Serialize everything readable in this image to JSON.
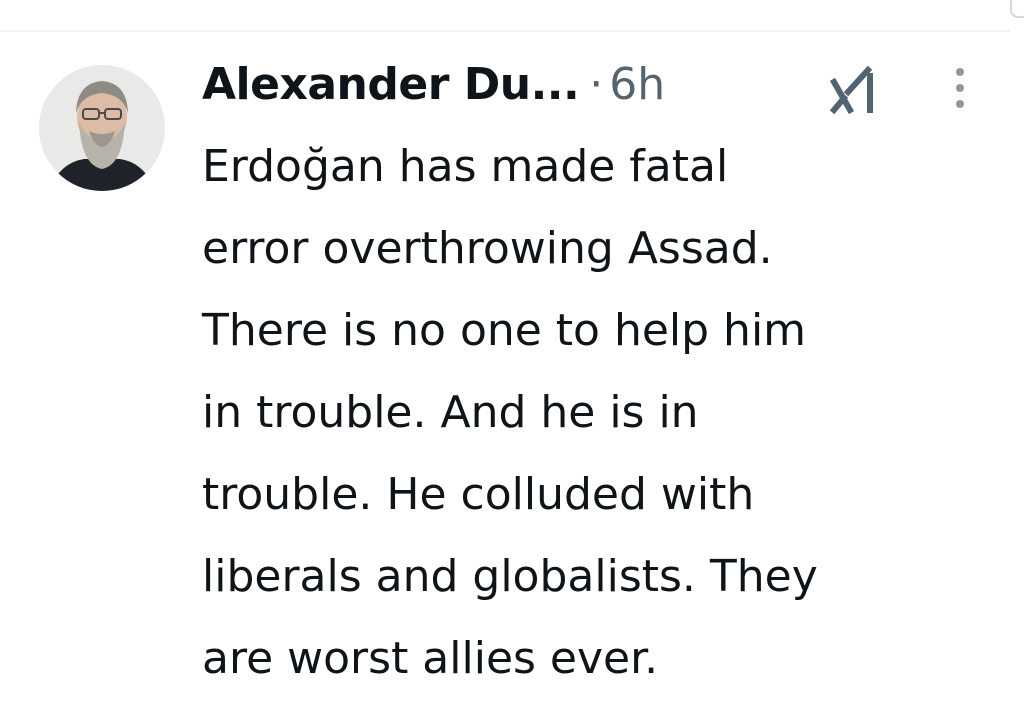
{
  "tweet": {
    "author_name": "Alexander Du...",
    "separator": "·",
    "time_ago": "6h",
    "text": "Erdoğan has made fatal\nerror overthrowing Assad.\nThere is no one to help him\nin trouble. And he is in\ntrouble. He colluded with\nliberals and globalists. They\nare worst allies ever."
  },
  "icons": {
    "avatar": "avatar-photo",
    "grok": "grok-icon",
    "more": "more-options-icon"
  },
  "colors": {
    "text_primary": "#0f1419",
    "text_secondary": "#536471",
    "divider": "#eff3f4",
    "icon": "#536471"
  }
}
